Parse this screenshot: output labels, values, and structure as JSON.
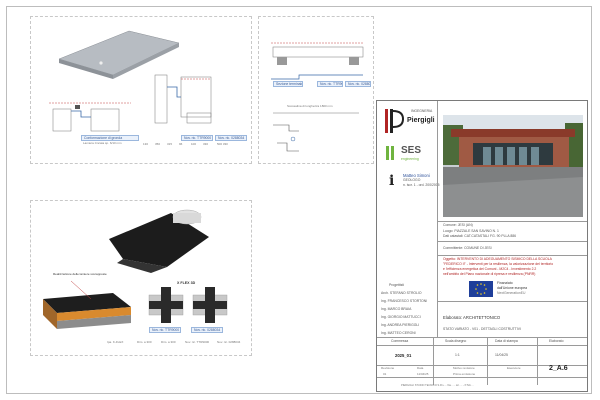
{
  "firm": {
    "name": "Piergigli",
    "tagline": "INGEGNERIA"
  },
  "ses": {
    "logo": "SES",
    "sub": "engineering"
  },
  "geologist": {
    "name": "Matteo Simoni",
    "role": "GEOLOGO",
    "reg": "n. iscr. 1 - ord. 200/2005"
  },
  "designers": {
    "label": "Progettisti",
    "names": [
      "Arch. STEFANO STROLIO",
      "Ing. FRANCESCO STORTONI",
      "Ing. MARCO BRAIA",
      "Ing. GIORGIO MATTUCCI",
      "Ing. ANDREA PIERIGGLI",
      "Ing. MATTEO CERONI"
    ]
  },
  "project": {
    "comune": "Comune:  JESI (AN)",
    "luogo": "Luogo: PIAZZALE SAN SAVINO N. 1",
    "catasto": "Dati catastali:  CAT.CATASTALI FG. 90 PLLA 886",
    "committente": "Committente:  COMUNE DI JESI",
    "oggetto": [
      "Oggetto:  INTERVENTO DI ADEGUAMENTO SISMICO DELLA SCUOLA",
      "\"FEDERICO II\" - Interventi per la resilienza, la valorizzazione del territorio",
      "e l'efficienza energetica dei Comuni - M2C4 - Investimento 2.2",
      "nell'ambito del Piano nazionale di ripresa e resilienza (PNRR)"
    ]
  },
  "eu": {
    "line1": "Finanziato",
    "line2": "dall'Unione europea",
    "line3": "NextGenerationEU"
  },
  "elaborato": {
    "label": "Elaborato:  ARCHITETTONICO",
    "state": "STATO VARIATO - V01 - DETTAGLI COSTRUTTIVI"
  },
  "table": {
    "headers": [
      "Commessa",
      "Scala disegno",
      "Data di stampa",
      "Elaborato"
    ],
    "values": [
      "2025_01",
      "1:1",
      "11/04/25",
      "2_A.6"
    ],
    "rev_headers": [
      "Revisione",
      "Data",
      "Motivo revisione",
      "Esecutore"
    ],
    "rev_row": [
      "01",
      "11/04/25",
      "Prima emissione",
      ""
    ]
  },
  "footer": "PIERGIGLI STUDIO TECNICO S.R.L. - Via ...  -  tel. ...  -  P.IVA ...",
  "panels": {
    "p1_caption": "Conformazione di gronda",
    "p1_sub": "Lamiera zincata sp. 6/10 mm",
    "p1_codes": [
      "Nov. ric. TTR9000",
      "Nov. ric. 0288034"
    ],
    "p1_dims": [
      "130",
      "350",
      "315",
      "96",
      "100",
      "330",
      "500 330"
    ],
    "p2_title": "Scossalina di lunghezza 1800 mm",
    "p2_codes": [
      "Nov. ric. TTR9000",
      "Nov. ric. 0288034"
    ],
    "p2_bar": "Sezione terminale",
    "p3_label": "Realizzazione delle lamiere sovrapposte",
    "p3_flex": "X FLEX 3D",
    "p3_codes": [
      "Nov. ric. TTR9000",
      "Nov. ric. 0288034"
    ],
    "p3_row": [
      "Ipa. K-FLEX",
      "Dim. a 300",
      "Dim. a 300",
      "Nov. ric. TTR9000",
      "Nov. ric. 0288034"
    ]
  },
  "colors": {
    "accent_blue": "#2b4f98",
    "accent_red": "#b02424",
    "roof_orange": "#d98a2e",
    "sheet_black": "#1c1c1c"
  }
}
